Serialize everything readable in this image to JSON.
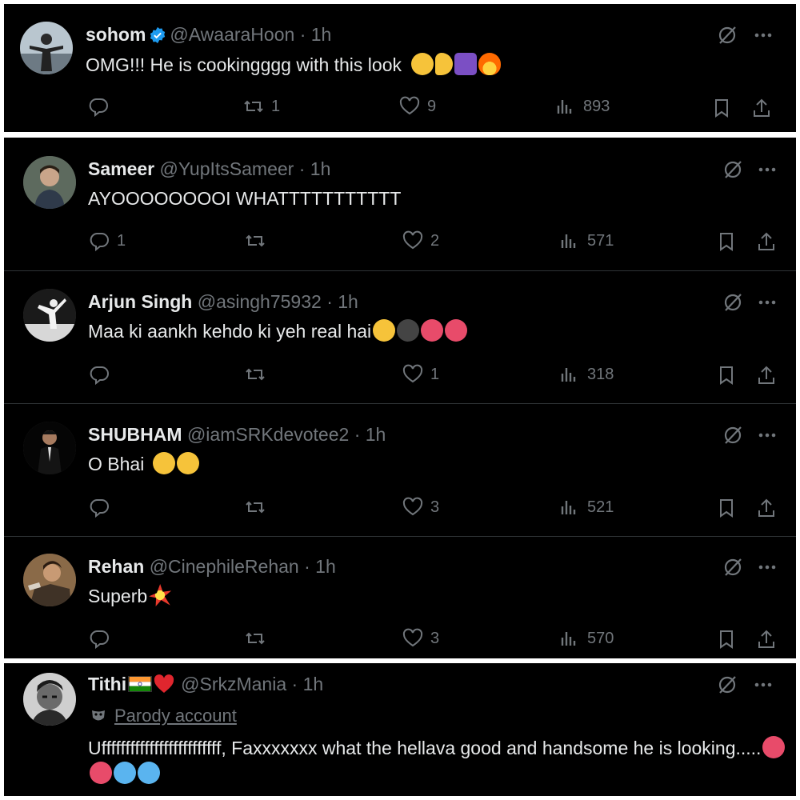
{
  "tweets": [
    {
      "name": "sohom",
      "handle": "@AwaaraHoon",
      "time": "· 1h",
      "verified": true,
      "text": "OMG!!! He is cookingggg with this look",
      "emojis": [
        "loudly-crying-face",
        "pinched-fingers",
        "place-of-worship",
        "fire"
      ],
      "replies": "",
      "retweets": "1",
      "likes": "9",
      "views": "893"
    },
    {
      "name": "Sameer",
      "handle": "@YupItsSameer",
      "time": "· 1h",
      "text": "AYOOOOOOOOI WHATTTTTTTTTTT",
      "emojis": [],
      "replies": "1",
      "retweets": "",
      "likes": "2",
      "views": "571"
    },
    {
      "name": "Arjun Singh",
      "handle": "@asingh75932",
      "time": "· 1h",
      "text": "Maa ki aankh kehdo ki yeh real hai",
      "emojis": [
        "face-screaming",
        "bomb",
        "smiling-face-with-horns",
        "smiling-face-with-horns"
      ],
      "replies": "",
      "retweets": "",
      "likes": "1",
      "views": "318"
    },
    {
      "name": "SHUBHAM",
      "handle": "@iamSRKdevotee2",
      "time": "· 1h",
      "text": "O Bhai",
      "emojis": [
        "exploding-head",
        "exploding-head"
      ],
      "replies": "",
      "retweets": "",
      "likes": "3",
      "views": "521"
    },
    {
      "name": "Rehan",
      "handle": "@CinephileRehan",
      "time": "· 1h",
      "text": "Superb",
      "emojis": [
        "collision"
      ],
      "replies": "",
      "retweets": "",
      "likes": "3",
      "views": "570"
    },
    {
      "name": "Tithi",
      "handle": "@SrkzMania",
      "time": "· 1h",
      "name_emojis": [
        "flag-india",
        "red-heart"
      ],
      "parody_label": "Parody account",
      "text": "Ufffffffffffffffffffffffff, Faxxxxxxx what the hellava good and handsome he is looking.....",
      "emojis": [
        "smiling-face-with-horns",
        "smiling-face-with-horns",
        "cold-face",
        "cold-face"
      ]
    }
  ],
  "icons": [
    "reply-icon",
    "retweet-icon",
    "like-icon",
    "views-icon",
    "bookmark-icon",
    "share-icon",
    "grok-icon",
    "more-icon",
    "verified-badge-icon",
    "parody-mask-icon"
  ],
  "colors": {
    "background": "#000000",
    "text": "#e7e9ea",
    "muted": "#71767b",
    "verified": "#1d9bf0",
    "divider": "#2f3336"
  }
}
